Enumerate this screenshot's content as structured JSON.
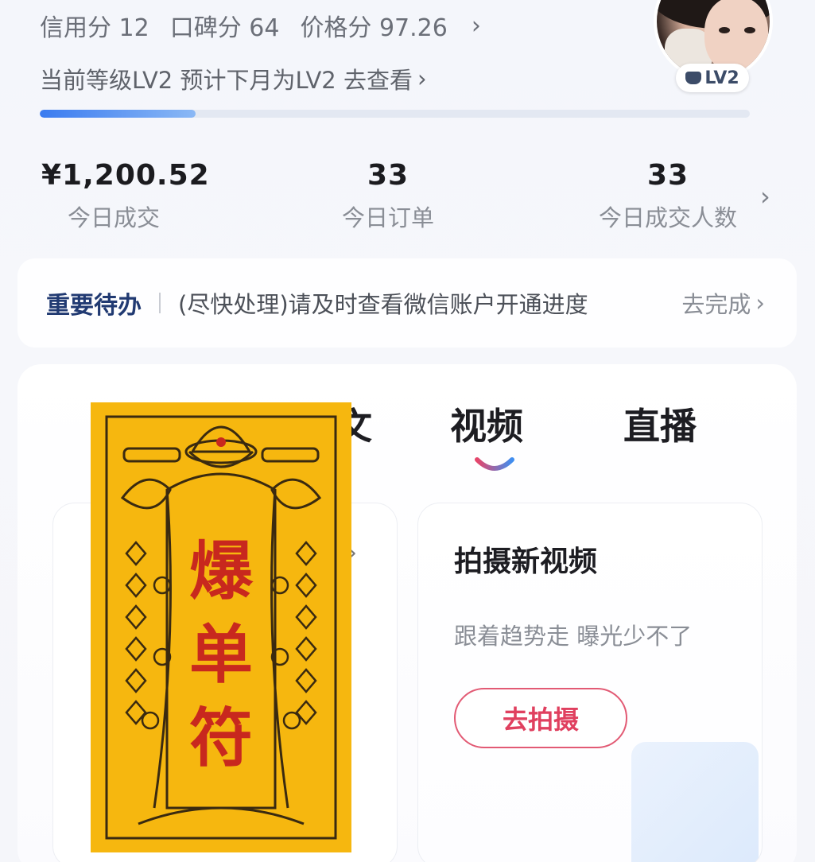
{
  "header": {
    "credit_score": "信用分 12",
    "reputation_score": "口碑分 64",
    "price_score": "价格分 97.26",
    "level_text": "当前等级LV2 预计下月为LV2 去查看",
    "level_progress": 0.22,
    "avatar_badge": "LV2"
  },
  "stats": {
    "items": [
      {
        "value": "¥1,200.52",
        "label": "今日成交"
      },
      {
        "value": "33",
        "label": "今日订单"
      },
      {
        "value": "33",
        "label": "今日成交人数"
      }
    ]
  },
  "todo": {
    "title": "重要待办",
    "message": "(尽快处理)请及时查看微信账户开通进度",
    "action": "去完成"
  },
  "tabs": {
    "partial": "文",
    "video": "视频",
    "live": "直播"
  },
  "video_card": {
    "title": "拍摄新视频",
    "subtitle": "跟着趋势走 曝光少不了",
    "button": "去拍摄"
  },
  "overlay": {
    "talisman_text": "爆单符"
  },
  "colors": {
    "accent_blue": "#3a7bf0",
    "accent_red": "#e0405f",
    "talisman_yellow": "#f6b70f",
    "talisman_red": "#c8281e"
  }
}
